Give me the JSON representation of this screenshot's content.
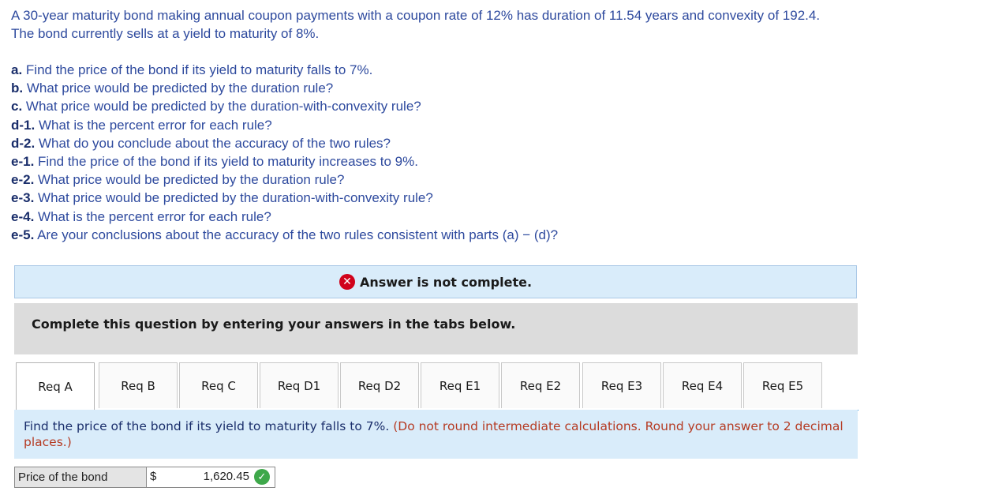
{
  "problem": {
    "line1": "A 30-year maturity bond making annual coupon payments with a coupon rate of 12% has duration of 11.54 years and convexity of 192.4.",
    "line2": "The bond currently sells at a yield to maturity of 8%."
  },
  "parts": [
    {
      "label": "a.",
      "text": " Find the price of the bond if its yield to maturity falls to 7%."
    },
    {
      "label": "b.",
      "text": " What price would be predicted by the duration rule?"
    },
    {
      "label": "c.",
      "text": " What price would be predicted by the duration-with-convexity rule?"
    },
    {
      "label": "d-1.",
      "text": " What is the percent error for each rule?"
    },
    {
      "label": "d-2.",
      "text": " What do you conclude about the accuracy of the two rules?"
    },
    {
      "label": "e-1.",
      "text": " Find the price of the bond if its yield to maturity increases to 9%."
    },
    {
      "label": "e-2.",
      "text": " What price would be predicted by the duration rule?"
    },
    {
      "label": "e-3.",
      "text": " What price would be predicted by the duration-with-convexity rule?"
    },
    {
      "label": "e-4.",
      "text": " What is the percent error for each rule?"
    },
    {
      "label": "e-5.",
      "text": " Are your conclusions about the accuracy of the two rules consistent with parts (a) − (d)?"
    }
  ],
  "status": {
    "icon": "x-circle-icon",
    "text": "Answer is not complete.",
    "color": "#d0021b"
  },
  "instructions": "Complete this question by entering your answers in the tabs below.",
  "tabs": [
    "Req A",
    "Req B",
    "Req C",
    "Req D1",
    "Req D2",
    "Req E1",
    "Req E2",
    "Req E3",
    "Req E4",
    "Req E5"
  ],
  "active_tab": "Req A",
  "question": {
    "text": "Find the price of the bond if its yield to maturity falls to 7%.",
    "hint": "(Do not round intermediate calculations. Round your answer to 2 decimal places.)"
  },
  "answer": {
    "label": "Price of the bond",
    "currency": "$",
    "value": "1,620.45",
    "status_icon": "check-circle-icon",
    "status_color": "#3ea84a"
  }
}
